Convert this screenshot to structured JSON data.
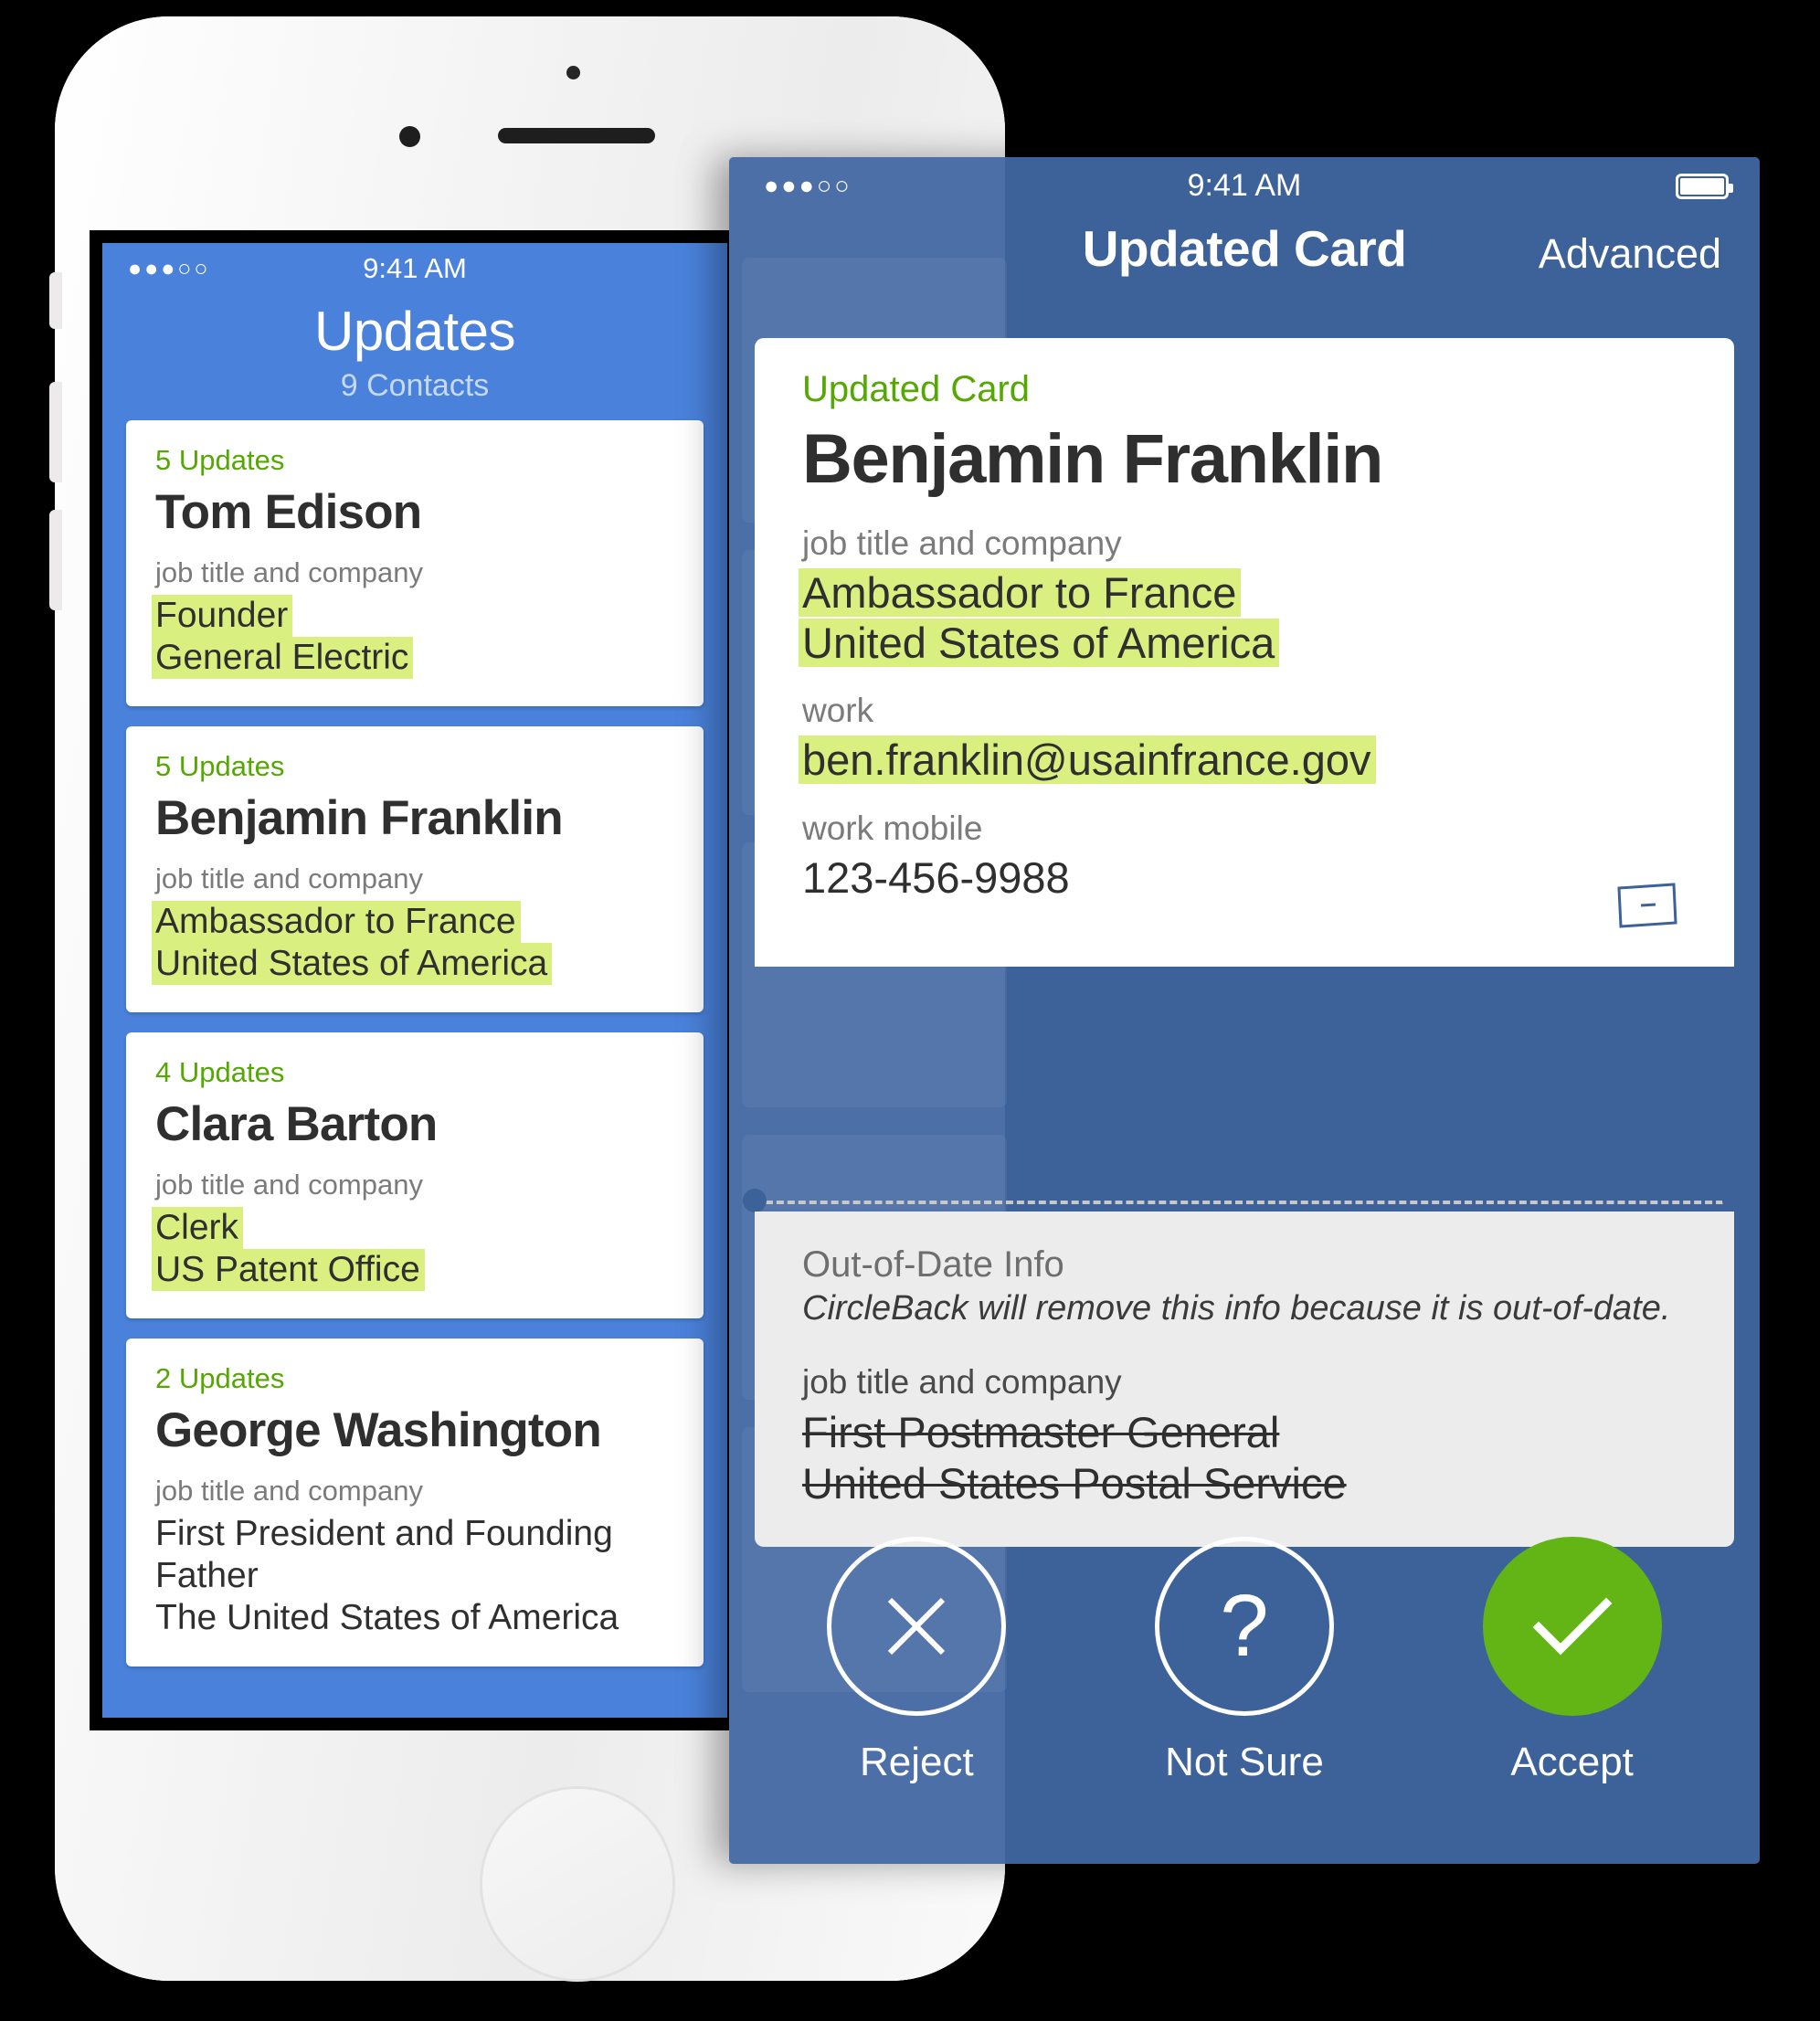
{
  "colors": {
    "blue": "#4a82db",
    "blue_dim": "#3d6199",
    "green": "#55a802",
    "accept_green": "#62b515",
    "highlight": "#d9ef7f",
    "gray_panel": "#ececec"
  },
  "back_phone": {
    "status": {
      "dots": "●●●○○",
      "clock": "9:41 AM"
    },
    "nav": {
      "title": "Updates",
      "subtitle": "9 Contacts"
    },
    "cards": [
      {
        "updates": "5 Updates",
        "name": "Tom Edison",
        "label": "job title and company",
        "line1": "Founder",
        "line2": "General Electric",
        "highlight1": true,
        "highlight2": true
      },
      {
        "updates": "5 Updates",
        "name": "Benjamin Franklin",
        "label": "job title and company",
        "line1": "Ambassador to France",
        "line2": "United States of America",
        "highlight1": true,
        "highlight2": true
      },
      {
        "updates": "4 Updates",
        "name": "Clara Barton",
        "label": "job title and company",
        "line1": "Clerk",
        "line2": "US Patent Office",
        "highlight1": true,
        "highlight2": true
      },
      {
        "updates": "2 Updates",
        "name": "George Washington",
        "label": "job title and company",
        "line1": "First President and Founding Father",
        "line2": "The United States of America",
        "highlight1": false,
        "highlight2": false
      }
    ]
  },
  "front_phone": {
    "status": {
      "dots": "●●●○○",
      "clock": "9:41 AM",
      "battery": "battery-icon"
    },
    "nav": {
      "title": "Updated Card",
      "advanced": "Advanced"
    },
    "updated_card": {
      "kicker": "Updated Card",
      "name": "Benjamin Franklin",
      "fields": [
        {
          "label": "job title and company",
          "line1": "Ambassador to France",
          "line2": "United States of America",
          "highlighted": true
        },
        {
          "label": "work",
          "line1": "ben.franklin@usainfrance.gov",
          "line2": "",
          "highlighted": true
        },
        {
          "label": "work mobile",
          "line1": "123-456-9988",
          "line2": "",
          "highlighted": false
        }
      ],
      "glyph": "card-icon"
    },
    "out_of_date": {
      "title": "Out-of-Date Info",
      "subtitle": "CircleBack will remove this info because it is out-of-date.",
      "label": "job title and company",
      "line1": "First Postmaster General",
      "line2": "United States Postal Service"
    },
    "actions": [
      {
        "icon": "close-icon",
        "glyph": "×",
        "caption": "Reject",
        "style": "outline"
      },
      {
        "icon": "question-icon",
        "glyph": "?",
        "caption": "Not Sure",
        "style": "outline"
      },
      {
        "icon": "check-icon",
        "glyph": "✓",
        "caption": "Accept",
        "style": "filled"
      }
    ]
  }
}
